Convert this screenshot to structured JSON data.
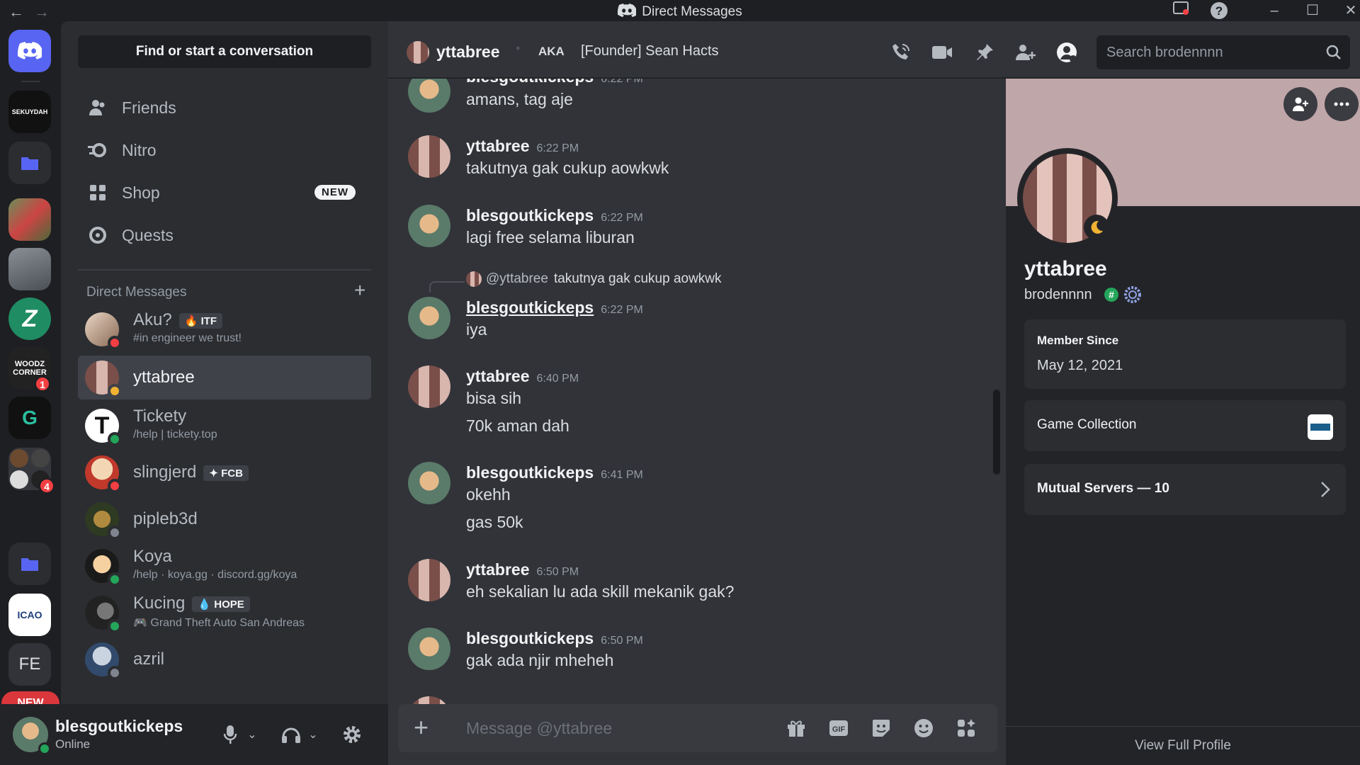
{
  "window": {
    "title": "Direct Messages"
  },
  "servers": {
    "items": [
      {
        "label": "SEKUYDAH"
      },
      {
        "label": ""
      },
      {
        "label": ""
      },
      {
        "label": ""
      },
      {
        "label": "WOODZ CORNER",
        "badge": "1"
      },
      {
        "label": "G"
      },
      {
        "label": "",
        "badge": "4"
      },
      {
        "label": "ICAO"
      },
      {
        "label": "FE"
      }
    ],
    "new_pill": "NEW"
  },
  "sidebar": {
    "find": "Find or start a conversation",
    "nav": [
      {
        "label": "Friends"
      },
      {
        "label": "Nitro"
      },
      {
        "label": "Shop",
        "tag": "NEW"
      },
      {
        "label": "Quests"
      }
    ],
    "dm_header": "Direct Messages",
    "dms": [
      {
        "name": "Aku?",
        "tag": "ITF",
        "sub": "#in engineer we trust!",
        "status": "dnd"
      },
      {
        "name": "yttabree",
        "status": "idle"
      },
      {
        "name": "Tickety",
        "sub": "/help | tickety.top",
        "status": "online"
      },
      {
        "name": "slingjerd",
        "tag": "FCB",
        "status": "dnd"
      },
      {
        "name": "pipleb3d",
        "status": "offline"
      },
      {
        "name": "Koya",
        "sub": "/help · koya.gg · discord.gg/koya",
        "status": "online"
      },
      {
        "name": "Kucing",
        "tag": "HOPE",
        "sub": "Grand Theft Auto San Andreas",
        "status": "online"
      },
      {
        "name": "azril",
        "status": "offline"
      }
    ]
  },
  "user_panel": {
    "name": "blesgoutkickeps",
    "status": "Online"
  },
  "chat_header": {
    "name": "yttabree",
    "aka": "AKA",
    "alias": "[Founder] Sean Hacts",
    "search_placeholder": "Search brodennnn"
  },
  "messages": [
    {
      "author": "blesgoutkickeps",
      "time": "6:22 PM",
      "lines": [
        "amans, tag aje"
      ]
    },
    {
      "author": "yttabree",
      "time": "6:22 PM",
      "lines": [
        "takutnya gak cukup aowkwk"
      ]
    },
    {
      "author": "blesgoutkickeps",
      "time": "6:22 PM",
      "lines": [
        "lagi free selama liburan"
      ]
    },
    {
      "author": "blesgoutkickeps",
      "time": "6:22 PM",
      "lines": [
        "iya"
      ],
      "reply": {
        "mention": "@yttabree",
        "text": "takutnya gak cukup aowkwk"
      }
    },
    {
      "author": "yttabree",
      "time": "6:40 PM",
      "lines": [
        "bisa sih",
        "70k aman dah"
      ]
    },
    {
      "author": "blesgoutkickeps",
      "time": "6:41 PM",
      "lines": [
        "okehh",
        "gas 50k"
      ]
    },
    {
      "author": "yttabree",
      "time": "6:50 PM",
      "lines": [
        "eh sekalian lu ada skill mekanik gak?"
      ]
    },
    {
      "author": "blesgoutkickeps",
      "time": "6:50 PM",
      "lines": [
        "gak ada njir mheheh"
      ]
    }
  ],
  "composer": {
    "placeholder": "Message @yttabree"
  },
  "profile": {
    "display_name": "yttabree",
    "username": "brodennnn",
    "member_since_label": "Member Since",
    "member_since": "May 12, 2021",
    "game_collection": "Game Collection",
    "mutual_servers": "Mutual Servers — 10",
    "view_full": "View Full Profile"
  },
  "colors": {
    "accent": "#5865f2",
    "online": "#23a55a",
    "idle": "#f0b232",
    "dnd": "#f23f43",
    "offline": "#80848e",
    "banner": "#bfa6a8"
  }
}
